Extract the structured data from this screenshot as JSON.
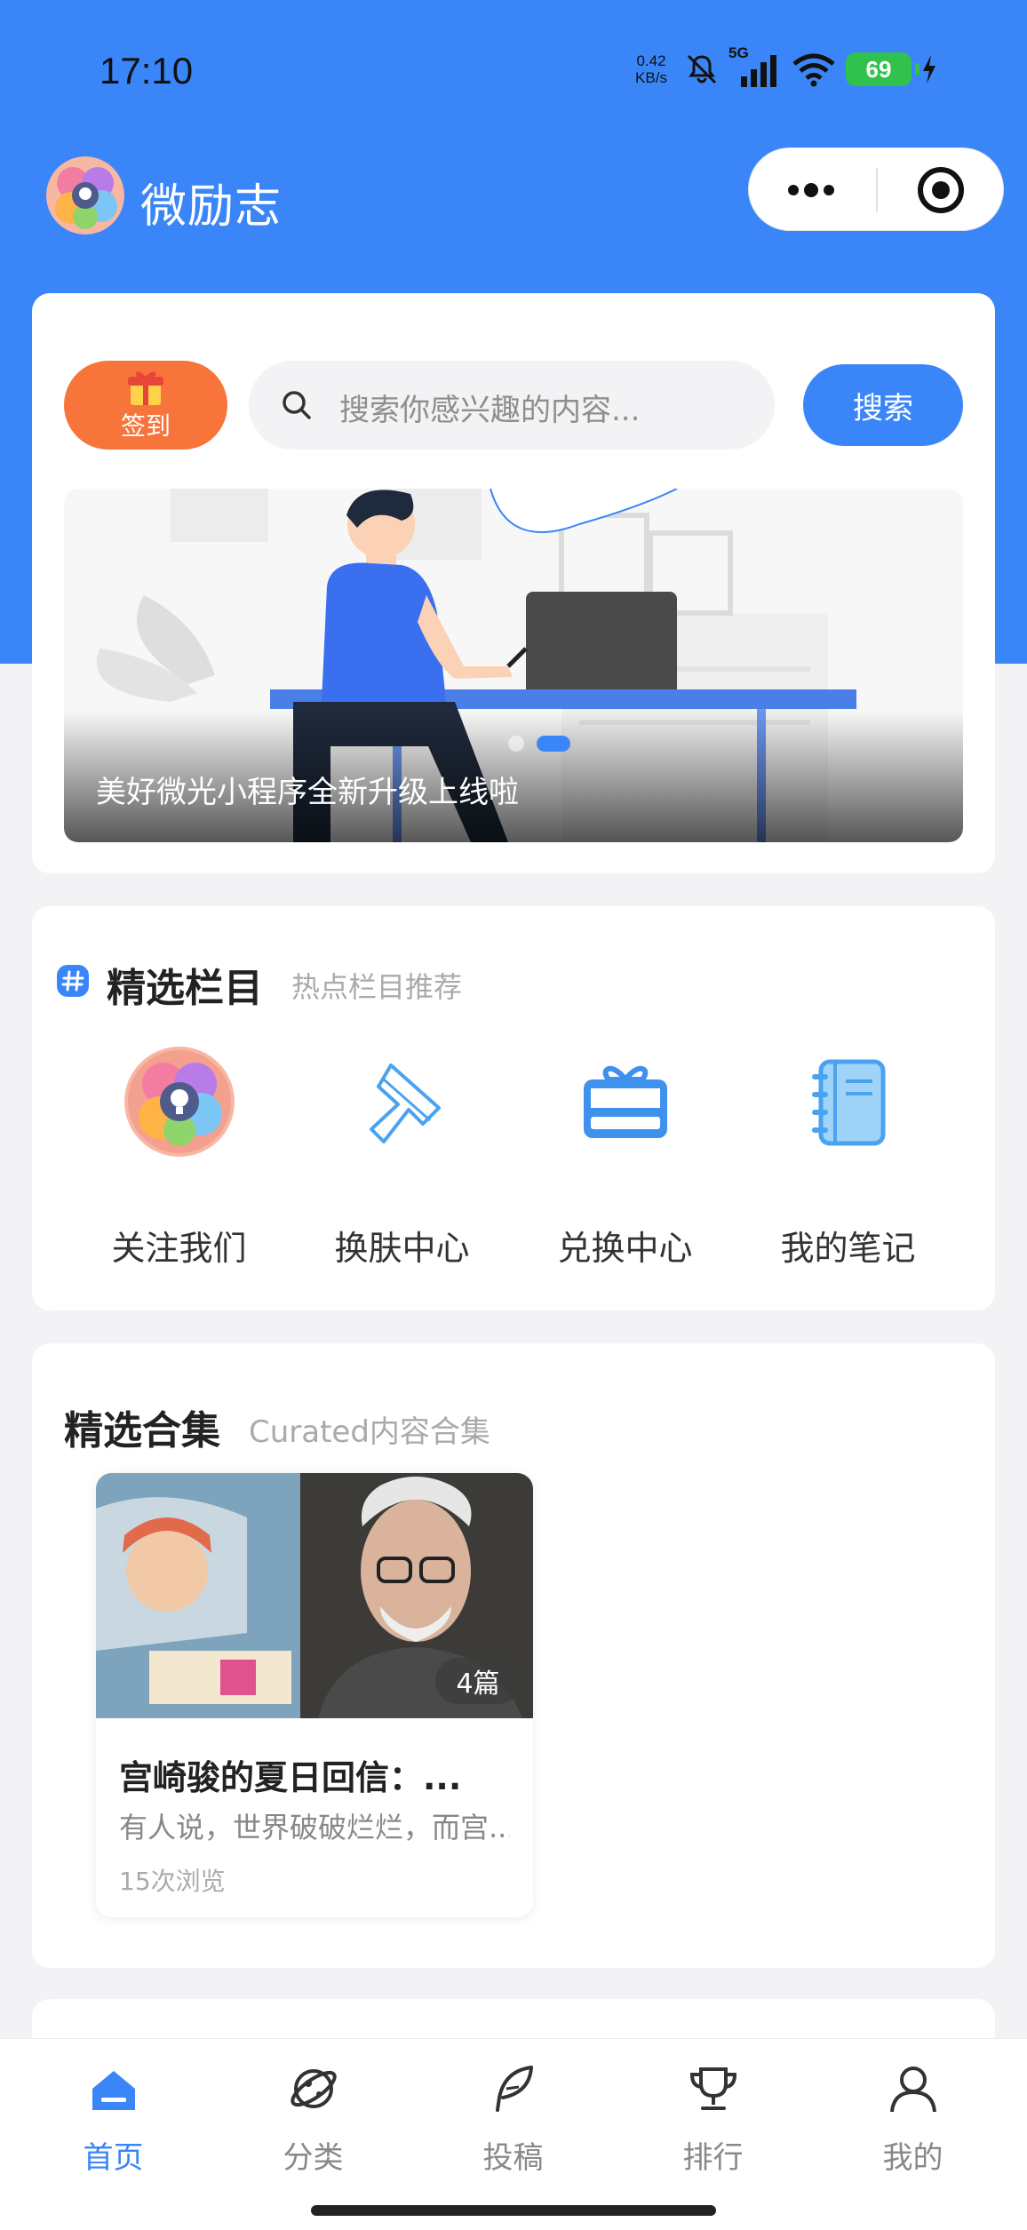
{
  "status_bar": {
    "time": "17:10",
    "net_speed_value": "0.42",
    "net_speed_unit": "KB/s",
    "network_type": "5G",
    "battery": "69"
  },
  "nav": {
    "title": "微励志"
  },
  "top_card": {
    "signin_label": "签到",
    "search_placeholder": "搜索你感兴趣的内容...",
    "search_button": "搜索",
    "banner_caption": "美好微光小程序全新升级上线啦"
  },
  "featured": {
    "title": "精选栏目",
    "subtitle": "热点栏目推荐",
    "items": [
      {
        "label": "关注我们",
        "icon": "app-logo-icon"
      },
      {
        "label": "换肤中心",
        "icon": "brush-icon"
      },
      {
        "label": "兑换中心",
        "icon": "gift-card-icon"
      },
      {
        "label": "我的笔记",
        "icon": "notebook-icon"
      }
    ]
  },
  "collections": {
    "title": "精选合集",
    "subtitle": "Curated内容合集",
    "items": [
      {
        "title": "宫崎骏的夏日回信：...",
        "description": "有人说，世界破破烂烂，而宫...",
        "views": "15次浏览",
        "count": "4篇"
      }
    ]
  },
  "tabbar": {
    "tabs": [
      {
        "label": "首页",
        "icon": "home-icon",
        "active": true
      },
      {
        "label": "分类",
        "icon": "planet-icon",
        "active": false
      },
      {
        "label": "投稿",
        "icon": "feather-icon",
        "active": false
      },
      {
        "label": "排行",
        "icon": "trophy-icon",
        "active": false
      },
      {
        "label": "我的",
        "icon": "user-icon",
        "active": false
      }
    ]
  },
  "colors": {
    "primary": "#3a86f8",
    "signin": "#f7743a",
    "battery": "#31c24d"
  }
}
